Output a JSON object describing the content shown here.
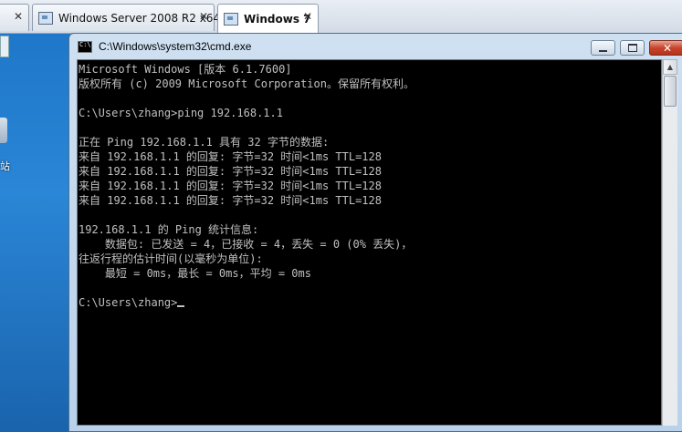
{
  "tabs": [
    {
      "label": "",
      "active": false
    },
    {
      "label": "Windows Server 2008 R2 x64",
      "active": false
    },
    {
      "label": "Windows 7",
      "active": true
    }
  ],
  "tab_close_glyph": "✕",
  "desktop": {
    "icon_label": "站"
  },
  "window": {
    "title": "C:\\Windows\\system32\\cmd.exe",
    "close_glyph": "✕"
  },
  "console": {
    "text": "Microsoft Windows [版本 6.1.7600]\n版权所有 (c) 2009 Microsoft Corporation。保留所有权利。\n\nC:\\Users\\zhang>ping 192.168.1.1\n\n正在 Ping 192.168.1.1 具有 32 字节的数据:\n来自 192.168.1.1 的回复: 字节=32 时间<1ms TTL=128\n来自 192.168.1.1 的回复: 字节=32 时间<1ms TTL=128\n来自 192.168.1.1 的回复: 字节=32 时间<1ms TTL=128\n来自 192.168.1.1 的回复: 字节=32 时间<1ms TTL=128\n\n192.168.1.1 的 Ping 统计信息:\n    数据包: 已发送 = 4，已接收 = 4，丢失 = 0 (0% 丢失)，\n往返行程的估计时间(以毫秒为单位):\n    最短 = 0ms，最长 = 0ms，平均 = 0ms\n\nC:\\Users\\zhang>"
  }
}
